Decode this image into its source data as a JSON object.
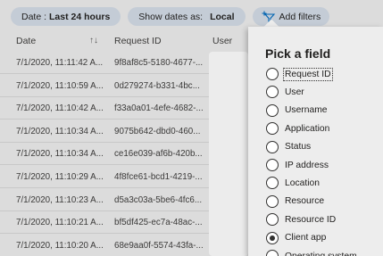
{
  "filters": {
    "date_prefix": "Date :",
    "date_value": "Last 24 hours",
    "show_prefix": "Show dates as:",
    "show_value": "Local",
    "add_label": "Add filters"
  },
  "table": {
    "columns": {
      "date": "Date",
      "request_id": "Request ID",
      "user": "User"
    },
    "rows": [
      {
        "date": "7/1/2020, 11:11:42 A...",
        "request_id": "9f8af8c5-5180-4677-..."
      },
      {
        "date": "7/1/2020, 11:10:59 A...",
        "request_id": "0d279274-b331-4bc..."
      },
      {
        "date": "7/1/2020, 11:10:42 A...",
        "request_id": "f33a0a01-4efe-4682-..."
      },
      {
        "date": "7/1/2020, 11:10:34 A...",
        "request_id": "9075b642-dbd0-460..."
      },
      {
        "date": "7/1/2020, 11:10:34 A...",
        "request_id": "ce16e039-af6b-420b..."
      },
      {
        "date": "7/1/2020, 11:10:29 A...",
        "request_id": "4f8fce61-bcd1-4219-..."
      },
      {
        "date": "7/1/2020, 11:10:23 A...",
        "request_id": "d5a3c03a-5be6-4fc6..."
      },
      {
        "date": "7/1/2020, 11:10:21 A...",
        "request_id": "bf5df425-ec7a-48ac-..."
      },
      {
        "date": "7/1/2020, 11:10:20 A...",
        "request_id": "68e9aa0f-5574-43fa-..."
      }
    ]
  },
  "panel": {
    "title": "Pick a field",
    "options": [
      {
        "label": "Request ID",
        "checked": false,
        "focused": true
      },
      {
        "label": "User",
        "checked": false
      },
      {
        "label": "Username",
        "checked": false
      },
      {
        "label": "Application",
        "checked": false
      },
      {
        "label": "Status",
        "checked": false
      },
      {
        "label": "IP address",
        "checked": false
      },
      {
        "label": "Location",
        "checked": false
      },
      {
        "label": "Resource",
        "checked": false
      },
      {
        "label": "Resource ID",
        "checked": false
      },
      {
        "label": "Client app",
        "checked": true
      },
      {
        "label": "Operating system",
        "checked": false
      }
    ]
  }
}
